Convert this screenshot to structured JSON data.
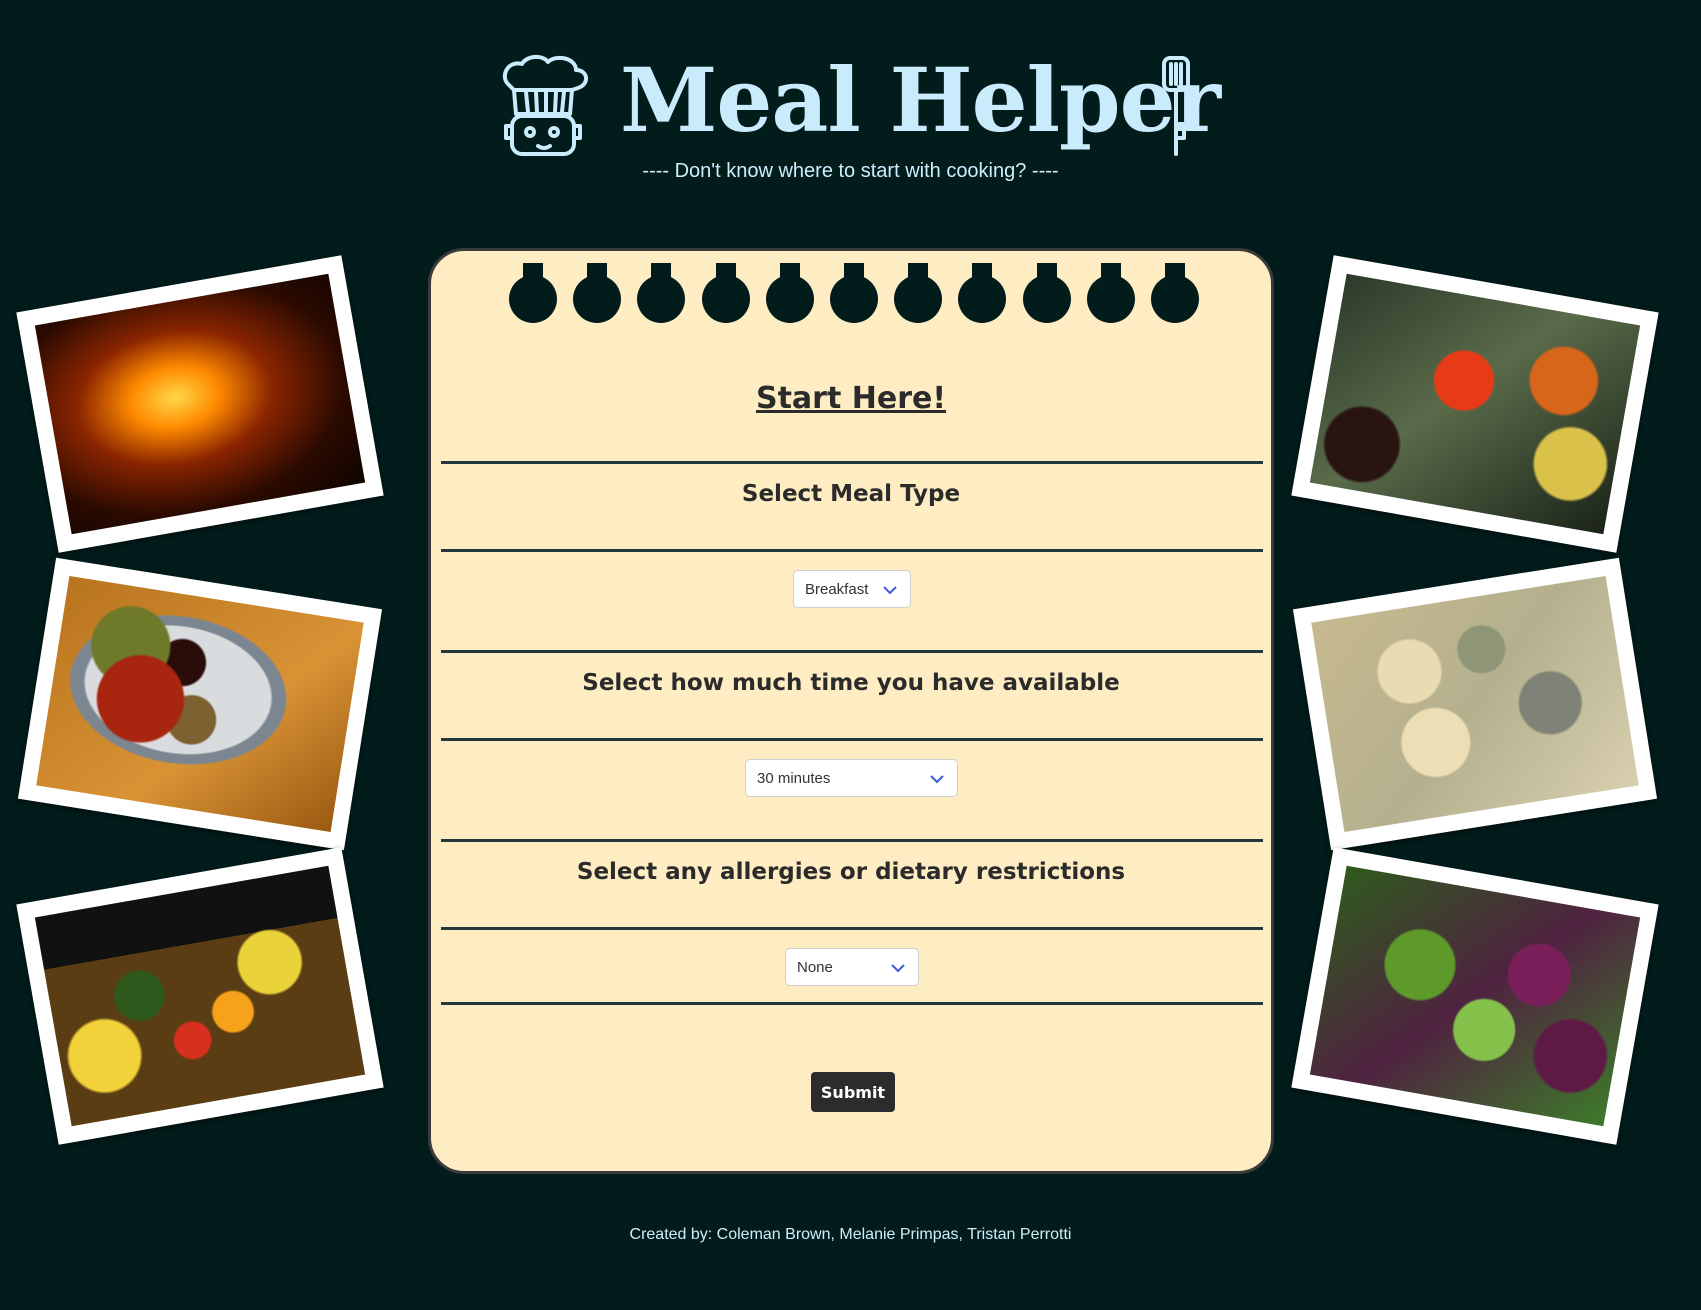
{
  "header": {
    "title": "Meal Helper",
    "tagline": "---- Don't know where to start with cooking? ----"
  },
  "form": {
    "heading": "Start Here!",
    "meal_type": {
      "label": "Select Meal Type",
      "value": "Breakfast"
    },
    "time": {
      "label": "Select how much time you have available",
      "value": "30 minutes"
    },
    "allergies": {
      "label": "Select any allergies or dietary restrictions",
      "value": "None"
    },
    "submit_label": "Submit"
  },
  "footer": {
    "credits": "Created by: Coleman Brown, Melanie Primpas, Tristan Perrotti"
  },
  "theme": {
    "background": "#021c1b",
    "paper": "#feedc2",
    "title_color": "#c9ebfb",
    "text_dark": "#2b2b2b",
    "button": "#2c2c2c"
  }
}
